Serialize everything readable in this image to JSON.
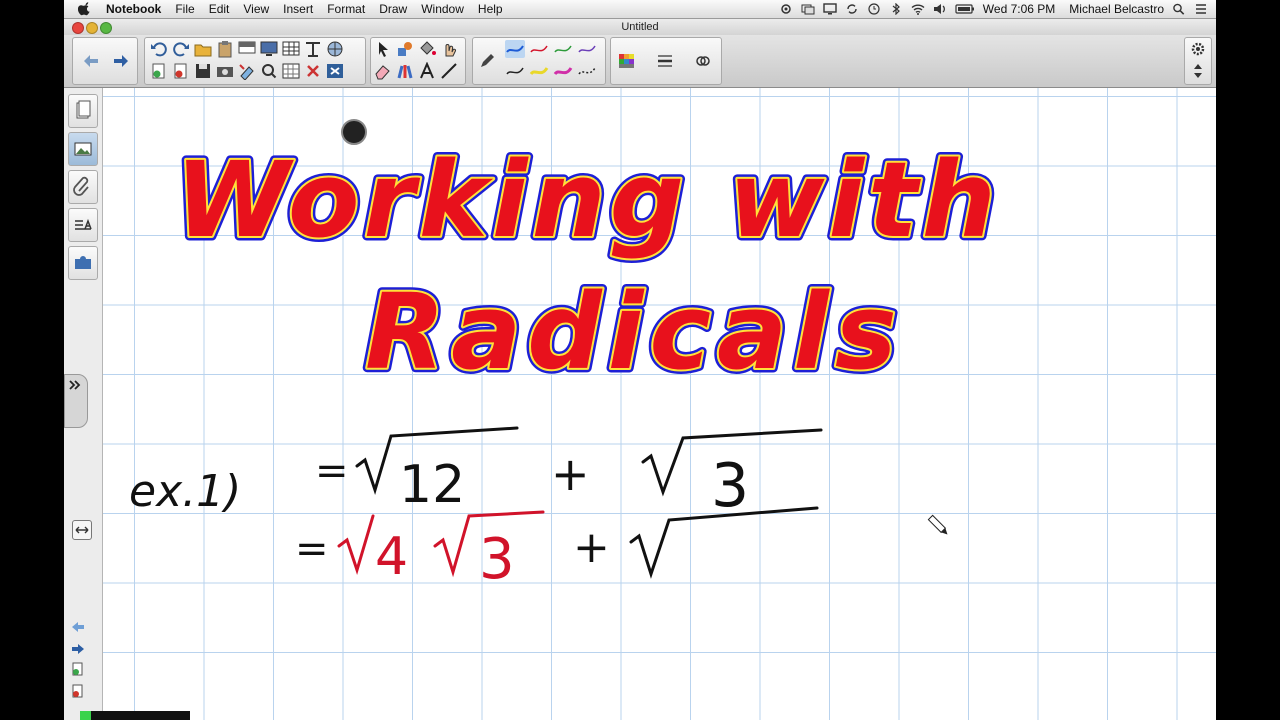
{
  "menubar": {
    "app_name": "Notebook",
    "menus": [
      "File",
      "Edit",
      "View",
      "Insert",
      "Format",
      "Draw",
      "Window",
      "Help"
    ],
    "clock": "Wed 7:06 PM",
    "user": "Michael Belcastro"
  },
  "window": {
    "title": "Untitled"
  },
  "canvas": {
    "title_line1": "Working with",
    "title_line2": "Radicals",
    "example_label": "ex.1)",
    "line1_eq": "=",
    "line1_rad1": "12",
    "line1_plus": "+",
    "line1_rad2": "3",
    "line2_eq": "=",
    "line2_rad1": "4",
    "line2_rad2": "3",
    "line2_plus": "+"
  },
  "colors": {
    "title_fill": "#e8111c",
    "title_outline": "#1d1fd6",
    "title_inner": "#ffe23a",
    "ink_red": "#d1132a",
    "grid": "#b9d3ee"
  },
  "progress": {
    "value": 0.1
  }
}
